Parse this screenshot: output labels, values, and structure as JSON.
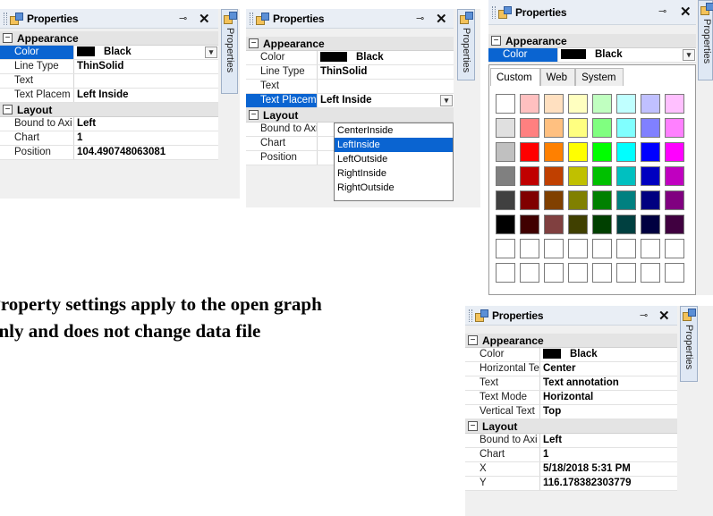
{
  "panel1": {
    "title": "Properties",
    "pin": "⊸",
    "close": "✕",
    "side_tab": "Properties",
    "appearance": "Appearance",
    "rows_appearance": [
      {
        "key": "Color",
        "value": "Black",
        "selected": true
      },
      {
        "key": "Line Type",
        "value": "ThinSolid"
      },
      {
        "key": "Text",
        "value": ""
      },
      {
        "key": "Text Placem",
        "value": "Left Inside"
      }
    ],
    "layout": "Layout",
    "rows_layout": [
      {
        "key": "Bound to Axi",
        "value": "Left"
      },
      {
        "key": "Chart",
        "value": "1"
      },
      {
        "key": "Position",
        "value": "104.490748063081"
      }
    ]
  },
  "panel2": {
    "title": "Properties",
    "pin": "⊸",
    "close": "✕",
    "side_tab": "Properties",
    "appearance": "Appearance",
    "rows_appearance": [
      {
        "key": "Color",
        "value": "Black"
      },
      {
        "key": "Line Type",
        "value": "ThinSolid"
      },
      {
        "key": "Text",
        "value": ""
      },
      {
        "key": "Text Placem",
        "value": "Left Inside",
        "selected": true
      }
    ],
    "layout": "Layout",
    "rows_layout": [
      {
        "key": "Bound to Axi",
        "value": ""
      },
      {
        "key": "Chart",
        "value": ""
      },
      {
        "key": "Position",
        "value": ""
      }
    ],
    "dropdown_options": [
      "CenterInside",
      "LeftInside",
      "LeftOutside",
      "RightInside",
      "RightOutside"
    ],
    "dropdown_selected": 1
  },
  "panel3": {
    "title": "Properties",
    "pin": "⊸",
    "close": "✕",
    "side_tab": "Properties",
    "appearance": "Appearance",
    "color_key": "Color",
    "color_value": "Black",
    "tabs": [
      "Custom",
      "Web",
      "System"
    ],
    "palette": [
      [
        "#ffffff",
        "#ffc0c0",
        "#ffe0c0",
        "#ffffc0",
        "#c0ffc0",
        "#c0ffff",
        "#c0c0ff",
        "#ffc0ff"
      ],
      [
        "#e0e0e0",
        "#ff8080",
        "#ffc080",
        "#ffff80",
        "#80ff80",
        "#80ffff",
        "#8080ff",
        "#ff80ff"
      ],
      [
        "#c0c0c0",
        "#ff0000",
        "#ff8000",
        "#ffff00",
        "#00ff00",
        "#00ffff",
        "#0000ff",
        "#ff00ff"
      ],
      [
        "#808080",
        "#c00000",
        "#c04000",
        "#c0c000",
        "#00c000",
        "#00c0c0",
        "#0000c0",
        "#c000c0"
      ],
      [
        "#404040",
        "#800000",
        "#804000",
        "#808000",
        "#008000",
        "#008080",
        "#000080",
        "#800080"
      ],
      [
        "#000000",
        "#400000",
        "#804040",
        "#404000",
        "#004000",
        "#004040",
        "#000040",
        "#400040"
      ],
      [
        "#ffffff",
        "#ffffff",
        "#ffffff",
        "#ffffff",
        "#ffffff",
        "#ffffff",
        "#ffffff",
        "#ffffff"
      ],
      [
        "#ffffff",
        "#ffffff",
        "#ffffff",
        "#ffffff",
        "#ffffff",
        "#ffffff",
        "#ffffff",
        "#ffffff"
      ]
    ]
  },
  "panel4": {
    "title": "Properties",
    "pin": "⊸",
    "close": "✕",
    "side_tab": "Properties",
    "appearance": "Appearance",
    "rows_appearance": [
      {
        "key": "Color",
        "value": "Black",
        "swatch": true
      },
      {
        "key": "Horizontal Te",
        "value": "Center"
      },
      {
        "key": "Text",
        "value": "Text annotation"
      },
      {
        "key": "Text Mode",
        "value": "Horizontal"
      },
      {
        "key": "Vertical Text",
        "value": "Top"
      }
    ],
    "layout": "Layout",
    "rows_layout": [
      {
        "key": "Bound to Axi",
        "value": "Left"
      },
      {
        "key": "Chart",
        "value": "1"
      },
      {
        "key": "X",
        "value": "5/18/2018 5:31 PM"
      },
      {
        "key": "Y",
        "value": "116.178382303779"
      }
    ]
  },
  "caption": {
    "line1": "Property settings apply to the open graph",
    "line2": "only and does not change data file"
  },
  "colors": {
    "selection": "#0a64d1",
    "titlebar": "#e9eef5",
    "category": "#e4e4e4"
  }
}
